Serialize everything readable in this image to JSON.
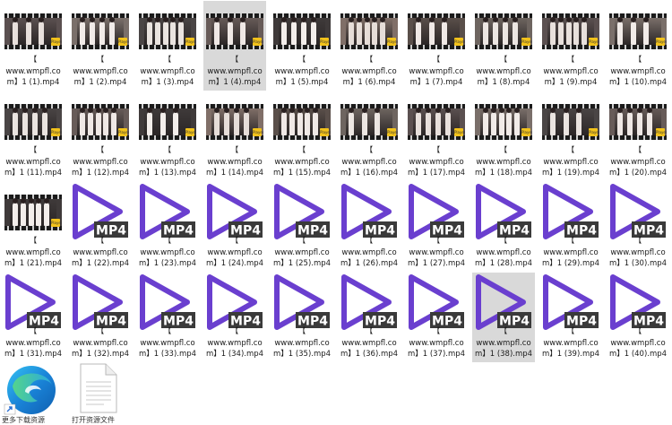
{
  "files": [
    {
      "bracket": "【",
      "line1": "www.wmpfl.co",
      "line2": "m】1 (1).mp4",
      "type": "video"
    },
    {
      "bracket": "【",
      "line1": "www.wmpfl.co",
      "line2": "m】1 (2).mp4",
      "type": "video"
    },
    {
      "bracket": "【",
      "line1": "www.wmpfl.co",
      "line2": "m】1 (3).mp4",
      "type": "video"
    },
    {
      "bracket": "【",
      "line1": "www.wmpfl.co",
      "line2": "m】1 (4).mp4",
      "type": "video",
      "selected": true
    },
    {
      "bracket": "【",
      "line1": "www.wmpfl.co",
      "line2": "m】1 (5).mp4",
      "type": "video"
    },
    {
      "bracket": "【",
      "line1": "www.wmpfl.co",
      "line2": "m】1 (6).mp4",
      "type": "video"
    },
    {
      "bracket": "【",
      "line1": "www.wmpfl.co",
      "line2": "m】1 (7).mp4",
      "type": "video"
    },
    {
      "bracket": "【",
      "line1": "www.wmpfl.co",
      "line2": "m】1 (8).mp4",
      "type": "video"
    },
    {
      "bracket": "【",
      "line1": "www.wmpfl.co",
      "line2": "m】1 (9).mp4",
      "type": "video"
    },
    {
      "bracket": "【",
      "line1": "www.wmpfl.co",
      "line2": "m】1 (10).mp4",
      "type": "video"
    },
    {
      "bracket": "【",
      "line1": "www.wmpfl.co",
      "line2": "m】1 (11).mp4",
      "type": "video"
    },
    {
      "bracket": "【",
      "line1": "www.wmpfl.co",
      "line2": "m】1 (12).mp4",
      "type": "video"
    },
    {
      "bracket": "【",
      "line1": "www.wmpfl.co",
      "line2": "m】1 (13).mp4",
      "type": "video"
    },
    {
      "bracket": "【",
      "line1": "www.wmpfl.co",
      "line2": "m】1 (14).mp4",
      "type": "video"
    },
    {
      "bracket": "【",
      "line1": "www.wmpfl.co",
      "line2": "m】1 (15).mp4",
      "type": "video"
    },
    {
      "bracket": "【",
      "line1": "www.wmpfl.co",
      "line2": "m】1 (16).mp4",
      "type": "video"
    },
    {
      "bracket": "【",
      "line1": "www.wmpfl.co",
      "line2": "m】1 (17).mp4",
      "type": "video"
    },
    {
      "bracket": "【",
      "line1": "www.wmpfl.co",
      "line2": "m】1 (18).mp4",
      "type": "video"
    },
    {
      "bracket": "【",
      "line1": "www.wmpfl.co",
      "line2": "m】1 (19).mp4",
      "type": "video"
    },
    {
      "bracket": "【",
      "line1": "www.wmpfl.co",
      "line2": "m】1 (20).mp4",
      "type": "video"
    },
    {
      "bracket": "【",
      "line1": "www.wmpfl.co",
      "line2": "m】1 (21).mp4",
      "type": "video"
    },
    {
      "bracket": "【",
      "line1": "www.wmpfl.co",
      "line2": "m】1 (22).mp4",
      "type": "mp4"
    },
    {
      "bracket": "【",
      "line1": "www.wmpfl.co",
      "line2": "m】1 (23).mp4",
      "type": "mp4"
    },
    {
      "bracket": "【",
      "line1": "www.wmpfl.co",
      "line2": "m】1 (24).mp4",
      "type": "mp4"
    },
    {
      "bracket": "【",
      "line1": "www.wmpfl.co",
      "line2": "m】1 (25).mp4",
      "type": "mp4"
    },
    {
      "bracket": "【",
      "line1": "www.wmpfl.co",
      "line2": "m】1 (26).mp4",
      "type": "mp4"
    },
    {
      "bracket": "【",
      "line1": "www.wmpfl.co",
      "line2": "m】1 (27).mp4",
      "type": "mp4"
    },
    {
      "bracket": "【",
      "line1": "www.wmpfl.co",
      "line2": "m】1 (28).mp4",
      "type": "mp4"
    },
    {
      "bracket": "【",
      "line1": "www.wmpfl.co",
      "line2": "m】1 (29).mp4",
      "type": "mp4"
    },
    {
      "bracket": "【",
      "line1": "www.wmpfl.co",
      "line2": "m】1 (30).mp4",
      "type": "mp4"
    },
    {
      "bracket": "【",
      "line1": "www.wmpfl.co",
      "line2": "m】1 (31).mp4",
      "type": "mp4"
    },
    {
      "bracket": "【",
      "line1": "www.wmpfl.co",
      "line2": "m】1 (32).mp4",
      "type": "mp4"
    },
    {
      "bracket": "【",
      "line1": "www.wmpfl.co",
      "line2": "m】1 (33).mp4",
      "type": "mp4"
    },
    {
      "bracket": "【",
      "line1": "www.wmpfl.co",
      "line2": "m】1 (34).mp4",
      "type": "mp4"
    },
    {
      "bracket": "【",
      "line1": "www.wmpfl.co",
      "line2": "m】1 (35).mp4",
      "type": "mp4"
    },
    {
      "bracket": "【",
      "line1": "www.wmpfl.co",
      "line2": "m】1 (36).mp4",
      "type": "mp4"
    },
    {
      "bracket": "【",
      "line1": "www.wmpfl.co",
      "line2": "m】1 (37).mp4",
      "type": "mp4"
    },
    {
      "bracket": "【",
      "line1": "www.wmpfl.co",
      "line2": "m】1 (38).mp4",
      "type": "mp4",
      "selected": true
    },
    {
      "bracket": "【",
      "line1": "www.wmpfl.co",
      "line2": "m】1 (39).mp4",
      "type": "mp4"
    },
    {
      "bracket": "【",
      "line1": "www.wmpfl.co",
      "line2": "m】1 (40).mp4",
      "type": "mp4"
    }
  ],
  "mp4_badge_text": "MP4",
  "thumbnail_badge_text": "Player",
  "colors": {
    "play_icon": "#6a3fcf",
    "badge_bg": "#3a3a3a",
    "selection": "#d9d9d9",
    "thumb_badge": "#f2c21b"
  },
  "bottom_items": [
    {
      "label": "更多下载资源",
      "icon": "edge-browser-icon"
    },
    {
      "label": "打开资源文件",
      "icon": "text-document-icon"
    }
  ]
}
